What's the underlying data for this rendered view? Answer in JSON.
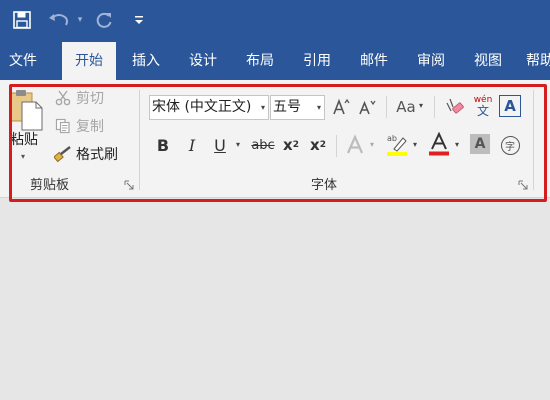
{
  "quick_access": {
    "icons": {
      "save": "save-icon",
      "undo": "undo-icon",
      "redo": "redo-icon",
      "customize": "customize-icon"
    }
  },
  "tabs": [
    {
      "label": "文件",
      "active": false
    },
    {
      "label": "开始",
      "active": true
    },
    {
      "label": "插入",
      "active": false
    },
    {
      "label": "设计",
      "active": false
    },
    {
      "label": "布局",
      "active": false
    },
    {
      "label": "引用",
      "active": false
    },
    {
      "label": "邮件",
      "active": false
    },
    {
      "label": "审阅",
      "active": false
    },
    {
      "label": "视图",
      "active": false
    },
    {
      "label": "帮助",
      "active": false
    }
  ],
  "clipboard": {
    "paste_label": "粘贴",
    "cut_label": "剪切",
    "copy_label": "复制",
    "format_painter_label": "格式刷",
    "group_label": "剪贴板"
  },
  "font": {
    "font_name_value": "宋体 (中文正文)",
    "font_size_value": "五号",
    "change_case_label": "Aa",
    "phonetic_label": "wén",
    "phonetic_char": "文",
    "bold_label": "B",
    "italic_label": "I",
    "underline_label": "U",
    "strikethrough_label": "abc",
    "subscript_label": "x",
    "subscript_mark": "2",
    "superscript_label": "x",
    "superscript_mark": "2",
    "group_label": "字体",
    "enclose_char": "字"
  },
  "colors": {
    "title_blue": "#2b579a",
    "ribbon_bg": "#f3f3f3",
    "highlight_red": "#d51d1d",
    "highlight_yellow": "#ffff00",
    "font_color_red": "#e02020"
  }
}
